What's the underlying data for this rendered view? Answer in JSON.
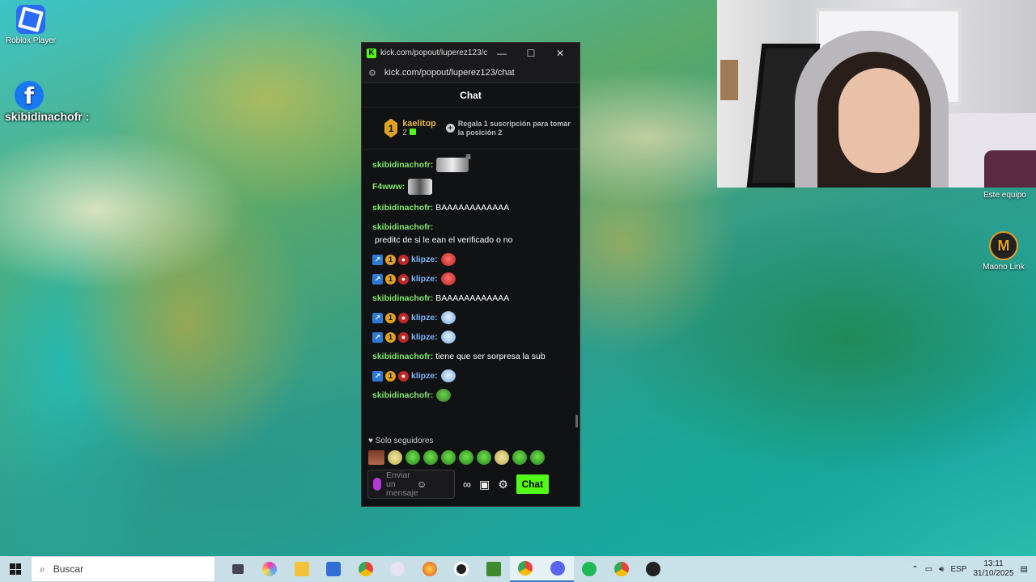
{
  "desktop": {
    "icons": [
      {
        "label": "Roblox Player"
      },
      {
        "label": "Maono Link"
      }
    ],
    "overlay_name": "skibidinachofr :"
  },
  "webcam": {
    "label": "Este equipo"
  },
  "popout": {
    "title": "kick.com/popout/luperez123/c...",
    "url": "kick.com/popout/luperez123/chat",
    "header": "Chat",
    "pinned": {
      "rank": "1",
      "user": "kaelitop",
      "count": "2",
      "note": "Regala 1 suscripción para tomar la posición 2"
    },
    "messages": [
      {
        "user": "skibidinachofr:",
        "text": "",
        "emote": "gray"
      },
      {
        "user": "F4www:",
        "text": "",
        "emote": "dog"
      },
      {
        "user": "skibidinachofr:",
        "text": "BAAAAAAAAAAAA"
      },
      {
        "user": "skibidinachofr:",
        "text": "preditc de si le ean el verificado o no"
      },
      {
        "user": "klipze:",
        "badges": true,
        "emote": "red"
      },
      {
        "user": "klipze:",
        "badges": true,
        "emote": "red"
      },
      {
        "user": "skibidinachofr:",
        "text": "BAAAAAAAAAAAA"
      },
      {
        "user": "klipze:",
        "badges": true,
        "emote": "blue"
      },
      {
        "user": "klipze:",
        "badges": true,
        "emote": "blue"
      },
      {
        "user": "skibidinachofr:",
        "text": "tiene que ser sorpresa la sub"
      },
      {
        "user": "klipze:",
        "badges": true,
        "emote": "blue"
      },
      {
        "user": "skibidinachofr:",
        "text": "",
        "emote": "pepe"
      }
    ],
    "followers_only": "Solo seguidores",
    "input_placeholder": "Enviar un mensaje",
    "send_label": "Chat"
  },
  "taskbar": {
    "search_placeholder": "Buscar",
    "lang": "ESP",
    "time": "13:11",
    "date": "31/10/2025"
  },
  "colors": {
    "kick_green": "#53fc18",
    "username_green": "#7ee86a",
    "username_blue": "#7ab8ff"
  }
}
